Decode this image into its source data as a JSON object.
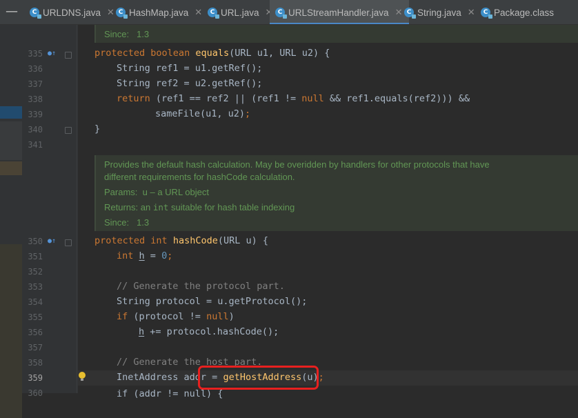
{
  "tabs": [
    {
      "name": "URLDNS.java",
      "closable": true,
      "active": false
    },
    {
      "name": "HashMap.java",
      "closable": true,
      "active": false
    },
    {
      "name": "URL.java",
      "closable": true,
      "active": false
    },
    {
      "name": "URLStreamHandler.java",
      "closable": true,
      "active": true
    },
    {
      "name": "String.java",
      "closable": true,
      "active": false
    },
    {
      "name": "Package.class",
      "closable": false,
      "active": false
    }
  ],
  "toolbar": {
    "collapse_symbol": "—"
  },
  "line_numbers": {
    "l335": "335",
    "l336": "336",
    "l337": "337",
    "l338": "338",
    "l339": "339",
    "l340": "340",
    "l341": "341",
    "l350": "350",
    "l351": "351",
    "l352": "352",
    "l353": "353",
    "l354": "354",
    "l355": "355",
    "l356": "356",
    "l357": "357",
    "l358": "358",
    "l359": "359",
    "l360": "360"
  },
  "doc_top": {
    "since_label": "Since:",
    "since_value": "1.3"
  },
  "doc_hash": {
    "line1": "Provides the default hash calculation. May be overidden by handlers for other protocols that have",
    "line2": "different requirements for hashCode calculation.",
    "params_label": "Params:",
    "params_value": "u – a URL object",
    "returns_label": "Returns:",
    "returns_pre": "an ",
    "returns_type": "int",
    "returns_post": " suitable for hash table indexing",
    "since_label": "Since:",
    "since_value": "1.3"
  },
  "code": {
    "protected": "protected",
    "boolean": "boolean",
    "equals": "equals",
    "equals_params": "(URL u1, URL u2) {",
    "ref1_decl": "String ref1 = u1.getRef",
    "ref2_decl": "String ref2 = u2.getRef",
    "call_end": "();",
    "return_kw": "return",
    "ret_a": " (ref1 == ref2 || (ref1 != ",
    "null": "null",
    "ret_b": " && ref1.equals(ref2))) &&",
    "samefile": "sameFile(u1, u2)",
    "semicolon": ";",
    "close_brace": "}",
    "int": "int",
    "hashcode": "hashCode",
    "hashcode_params": "(URL u) {",
    "h": "h",
    "h_init_a": " = ",
    "zero": "0",
    "comment_protocol": "// Generate the protocol part.",
    "protocol_decl": "String protocol = u.getProtocol",
    "if_kw": "if",
    "if_protocol_a": " (protocol != ",
    "if_protocol_b": ")",
    "h_plus": " += protocol.hashCode",
    "comment_host": "// Generate the host part.",
    "inet_decl": "InetAddress addr = ",
    "gethost": "getHostAddress",
    "gethost_args": "(u)",
    "cut_line": "if (addr != null) {"
  },
  "colors": {
    "annotation_box": "#e8201f",
    "keyword": "#cc7832",
    "method": "#ffc66d",
    "doc": "#629755"
  }
}
